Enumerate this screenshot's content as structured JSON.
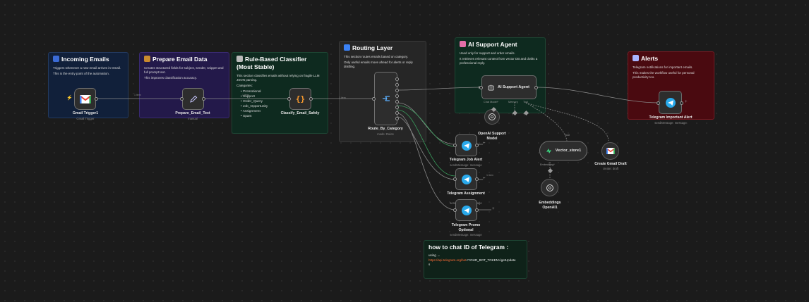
{
  "stickies": {
    "incoming": {
      "title": "Incoming Emails",
      "lines": [
        "Triggers whenever a new email arrives in Gmail.",
        "This is the entry point of the automation."
      ]
    },
    "prepare": {
      "title": "Prepare Email Data",
      "lines": [
        "Creates structured fields for subject, sender, snippet and full prompt text.",
        "This improves classification accuracy."
      ]
    },
    "classifier": {
      "title": "Rule-Based Classifier (Most Stable)",
      "lines": [
        "This section classifies emails without relying on fragile LLM JSON parsing.",
        "Categories:"
      ],
      "categories": [
        "Promotional",
        "Support",
        "Order_Query",
        "Job_Opportunity",
        "Assignment",
        "Spam"
      ]
    },
    "routing": {
      "title": "Routing Layer",
      "lines": [
        "This section routes emails based on category.",
        "Only useful emails move ahead for alerts or reply drafting."
      ]
    },
    "agent": {
      "title": "AI Support Agent",
      "lines": [
        "Used only for support and order emails.",
        "It retrieves relevant context from vector DB and drafts a professional reply."
      ]
    },
    "alerts": {
      "title": "Alerts",
      "lines": [
        "Telegram notifications for important emails.",
        "This makes the workflow useful for personal productivity too."
      ]
    },
    "chatid": {
      "title": "how to chat ID of Telegram :",
      "using": "using →",
      "url": "https://api.telegram.org/bot",
      "url_rest": "<YOUR_BOT_TOKEN>/getUpdate",
      "url_tail": "s"
    }
  },
  "nodes": {
    "gmail_trigger": {
      "name": "Gmail Trigger1",
      "sub": "Gmail Trigger"
    },
    "prepare": {
      "name": "Prepare_Email_Text",
      "sub": "manual"
    },
    "classify": {
      "name": "Classify_Email_Safely",
      "sub": ""
    },
    "route": {
      "name": "Route_By_Category",
      "sub": "mode: Rules"
    },
    "agent": {
      "name": "AI Support Agent",
      "port_labels": [
        "Chat Model*",
        "Memory",
        "Tool"
      ]
    },
    "important": {
      "name": "Telegram Important Alert",
      "sub": "sendMessage: message"
    },
    "openai_model": {
      "name": "OpenAI Support Model"
    },
    "job_alert": {
      "name": "Telegram Job Alert",
      "sub": "sendMessage: message"
    },
    "assignment": {
      "name": "Telegram Assignment",
      "sub": "sendMessage: message"
    },
    "promo": {
      "name": "Telegram Promo Optional",
      "sub": "sendMessage: message"
    },
    "vector": {
      "name": "Vector_store1",
      "port_labels": [
        "Embedding*"
      ],
      "top_label": "Tool"
    },
    "gmail_draft": {
      "name": "Create Gmail Draft",
      "sub": "create: draft"
    },
    "embeddings": {
      "name": "Embeddings OpenAI1"
    }
  },
  "edge_labels": {
    "item1": "1 item",
    "item2": "1 item",
    "item3": "1 item",
    "item4": "1 item"
  },
  "colors": {
    "accent": "#ff6d5a",
    "telegram": "#29a9eb",
    "edge": "#8a8a8a",
    "edge_active": "#3a9d5d"
  }
}
